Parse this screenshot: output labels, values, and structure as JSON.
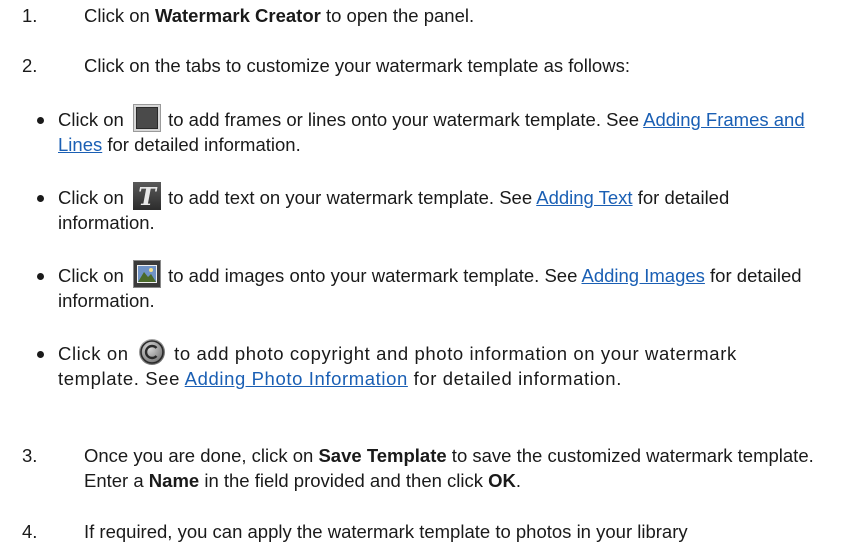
{
  "step1": {
    "num": "1.",
    "pre": "Click on ",
    "bold": "Watermark Creator",
    "post": " to open the panel."
  },
  "step2": {
    "num": "2.",
    "text": "Click on the tabs to customize your watermark template as follows:"
  },
  "bullets": [
    {
      "pre": "Click on",
      "icon": "frame-icon",
      "mid": " to add frames or lines onto your watermark template. See ",
      "link": "Adding Frames and Lines",
      "post": " for detailed information."
    },
    {
      "pre": "Click on",
      "icon": "text-t-icon",
      "mid": " to add text on your watermark template. See ",
      "link": "Adding Text",
      "post": " for detailed information."
    },
    {
      "pre": "Click on",
      "icon": "image-icon",
      "mid": " to add images onto your watermark template. See ",
      "link": "Adding Images",
      "post": " for detailed information."
    },
    {
      "pre": "Click on",
      "icon": "copyright-icon",
      "mid": " to add photo copyright and photo information on your watermark template. See ",
      "link": "Adding Photo Information",
      "post": " for detailed information."
    }
  ],
  "step3": {
    "num": "3.",
    "pre": "Once you are done, click on ",
    "bold1": "Save Template",
    "mid1": " to save the customized watermark template. Enter a ",
    "bold2": "Name",
    "mid2": " in the field provided and then click ",
    "bold3": "OK",
    "post": "."
  },
  "step4": {
    "num": "4.",
    "text": "If required, you can apply the watermark template to photos in your library"
  },
  "colors": {
    "link": "#1a5fb4",
    "text": "#1a1a1a"
  }
}
